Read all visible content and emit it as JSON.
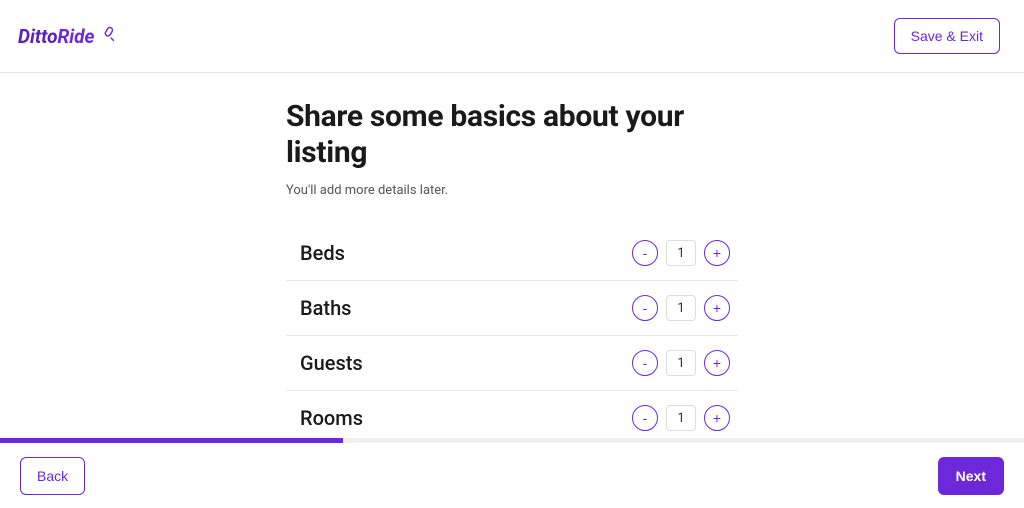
{
  "brand": {
    "name_part1": "Ditto",
    "name_part2": "Ride"
  },
  "header": {
    "save_exit_label": "Save & Exit"
  },
  "form": {
    "title": "Share some basics about your listing",
    "subtitle": "You'll add more details later.",
    "fields": [
      {
        "label": "Beds",
        "value": "1"
      },
      {
        "label": "Baths",
        "value": "1"
      },
      {
        "label": "Guests",
        "value": "1"
      },
      {
        "label": "Rooms",
        "value": "1"
      }
    ],
    "decrement_symbol": "-",
    "increment_symbol": "+"
  },
  "footer": {
    "back_label": "Back",
    "next_label": "Next"
  },
  "progress": {
    "percent": 33.5
  }
}
